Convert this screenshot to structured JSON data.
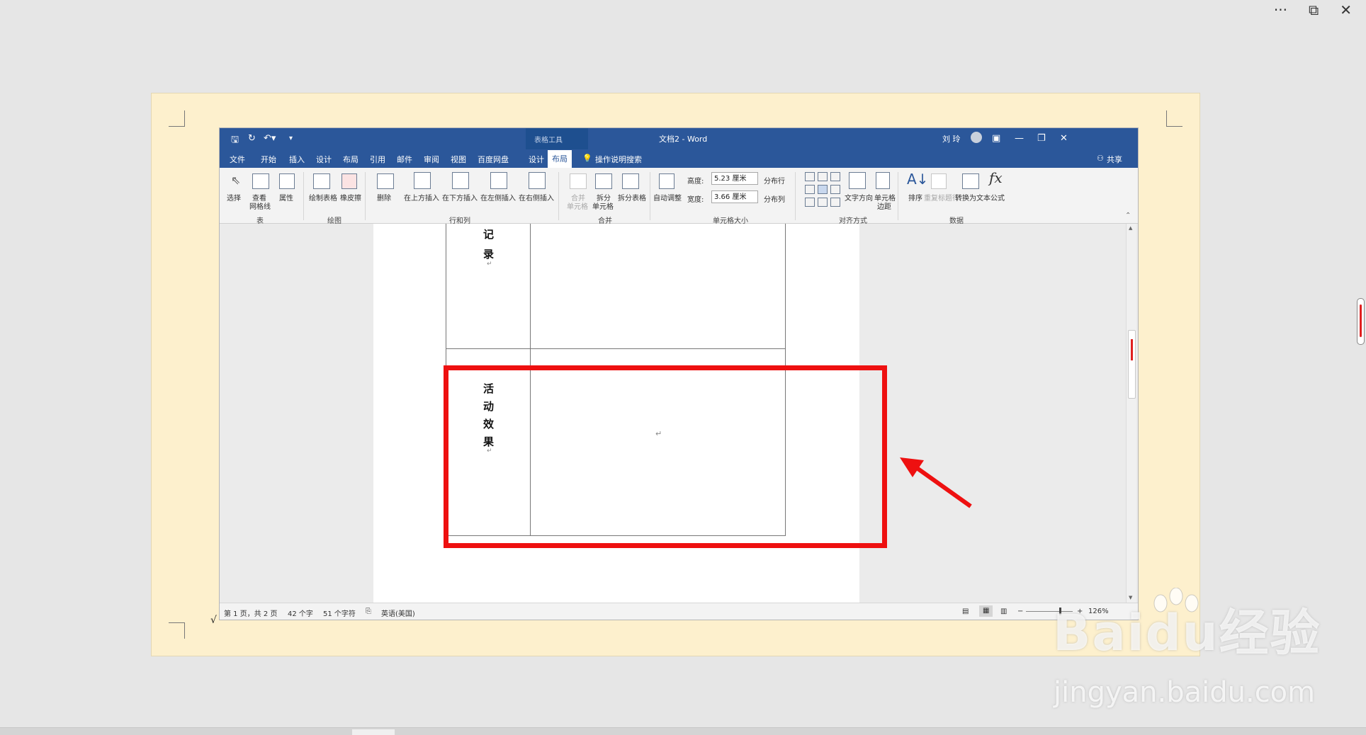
{
  "viewer": {
    "more_icon": "more-horizontal-icon",
    "window_icon": "pip-icon",
    "close_icon": "close-icon"
  },
  "titlebar": {
    "context_tab": "表格工具",
    "title": "文档2 - Word",
    "user": "刘 玲"
  },
  "tabs": [
    "文件",
    "开始",
    "插入",
    "设计",
    "布局",
    "引用",
    "邮件",
    "审阅",
    "视图",
    "百度网盘",
    "设计",
    "布局"
  ],
  "search_hint": "操作说明搜索",
  "share_label": "共享",
  "ribbon": {
    "table": {
      "group": "表",
      "select": "选择",
      "gridlines_1": "查看",
      "gridlines_2": "网格线",
      "properties": "属性"
    },
    "draw": {
      "group": "绘图",
      "draw_table": "绘制表格",
      "eraser": "橡皮擦"
    },
    "rows_cols": {
      "group": "行和列",
      "delete": "删除",
      "insert_above": "在上方插入",
      "insert_below": "在下方插入",
      "insert_left": "在左侧插入",
      "insert_right": "在右侧插入"
    },
    "merge": {
      "group": "合并",
      "merge_1": "合并",
      "merge_2": "单元格",
      "split_1": "拆分",
      "split_2": "单元格",
      "split_table": "拆分表格"
    },
    "cell_size": {
      "group": "单元格大小",
      "autofit": "自动调整",
      "height_label": "高度:",
      "height_value": "5.23 厘米",
      "width_label": "宽度:",
      "width_value": "3.66 厘米",
      "dist_rows": "分布行",
      "dist_cols": "分布列"
    },
    "alignment": {
      "group": "对齐方式",
      "text_direction": "文字方向",
      "margins_1": "单元格",
      "margins_2": "边距"
    },
    "data": {
      "group": "数据",
      "sort": "排序",
      "repeat_header": "重复标题行",
      "to_text": "转换为文本",
      "formula": "公式"
    }
  },
  "document": {
    "row1_chars": [
      "记",
      "录"
    ],
    "row2_chars": [
      "活",
      "动",
      "效",
      "果"
    ],
    "para_mark": "↵"
  },
  "status": {
    "page": "第 1 页，共 2 页",
    "words": "42 个字",
    "chars": "51 个字符",
    "language": "英语(美国)",
    "zoom": "126%",
    "zoom_fraction": 0.72
  },
  "watermark": {
    "logo": "Baidu经验",
    "url": "jingyan.baidu.com"
  },
  "check_mark": "√"
}
